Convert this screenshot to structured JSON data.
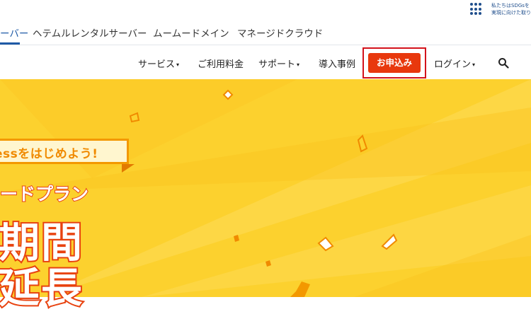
{
  "sdgs": {
    "line1": "私たちはSDGsを",
    "line2": "実現に向けた取り"
  },
  "brand_tabs": [
    {
      "label": "ーバー",
      "active": true
    },
    {
      "label": "ヘテムルレンタルサーバー",
      "active": false
    },
    {
      "label": "ムームードメイン",
      "active": false
    },
    {
      "label": "マネージドクラウド",
      "active": false
    }
  ],
  "nav": {
    "services": "サービス",
    "pricing": "ご利用料金",
    "support": "サポート",
    "cases": "導入事例",
    "apply": "お申込み",
    "login": "ログイン",
    "caret": "▾"
  },
  "hero": {
    "banner": "essをはじめよう!",
    "plan": "ードプラン",
    "big_line1": "期間",
    "big_line2": "延長",
    "colors": {
      "background": "#fcd12e",
      "accent": "#e8420f",
      "banner_border": "#f39800"
    }
  },
  "icons": {
    "search": "search-icon",
    "sdgs": "sdgs-grid-icon"
  },
  "colors": {
    "apply_button": "#e8380d",
    "highlight": "#d3121b",
    "brand_active": "#1f5aa6"
  }
}
